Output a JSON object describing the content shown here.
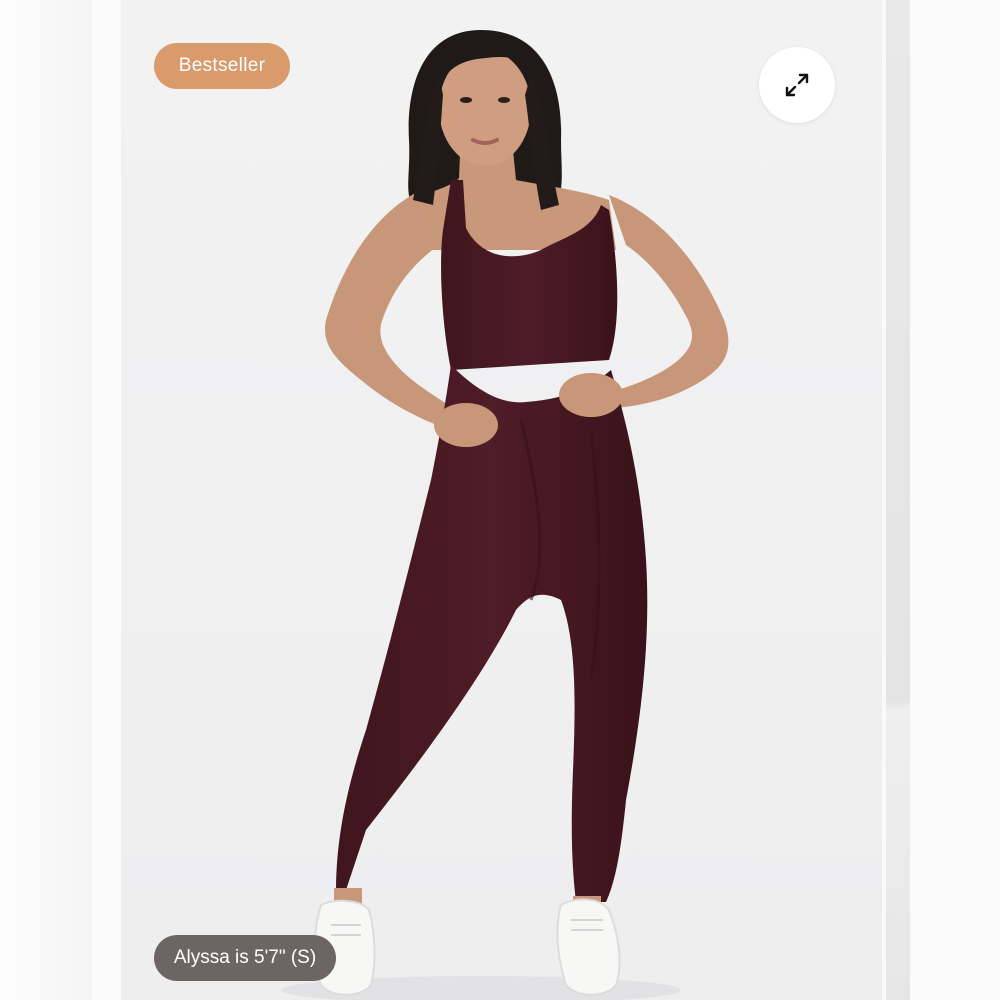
{
  "product_gallery": {
    "badge": {
      "label": "Bestseller",
      "color": "#d99a6c"
    },
    "expand_button": {
      "icon": "expand-arrows-icon"
    },
    "model_info": {
      "label": "Alyssa is 5'7\" (S)"
    },
    "garment_color": "#4a1a24"
  }
}
